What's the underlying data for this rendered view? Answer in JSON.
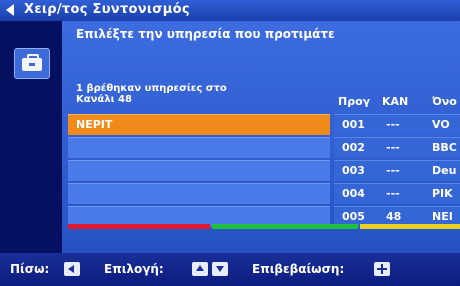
{
  "header": {
    "title": "Χειρ/τος Συντονισμός",
    "back_icon": "back-arrow-icon"
  },
  "sidebar": {
    "icon": "toolbox-icon"
  },
  "main": {
    "instruction": "Επιλέξτε την υπηρεσία που προτιμάτε",
    "found_line1": "1 βρέθηκαν υπηρεσίες στο",
    "found_line2": "Κανάλι 48"
  },
  "services": [
    {
      "name": "ΝΕΡΙΤ",
      "selected": true
    },
    {
      "name": "",
      "selected": false
    },
    {
      "name": "",
      "selected": false
    },
    {
      "name": "",
      "selected": false
    },
    {
      "name": "",
      "selected": false
    }
  ],
  "channel_table": {
    "headers": {
      "prog": "Προγ",
      "kan": "ΚΑΝ",
      "name": "Όνο"
    },
    "rows": [
      {
        "prog": "001",
        "kan": "---",
        "name": "VO"
      },
      {
        "prog": "002",
        "kan": "---",
        "name": "BBC"
      },
      {
        "prog": "003",
        "kan": "---",
        "name": "Deu"
      },
      {
        "prog": "004",
        "kan": "---",
        "name": "ΡΙΚ"
      },
      {
        "prog": "005",
        "kan": "48",
        "name": "ΝΕΙ"
      }
    ]
  },
  "footer": {
    "back_label": "Πίσω:",
    "select_label": "Επιλογή:",
    "confirm_label": "Επιβεβαίωση:"
  },
  "colors": {
    "background": "#0a1a78",
    "panel": "#2752c2",
    "selected": "#f08a1a",
    "bar_red": "#e0182e",
    "bar_green": "#1fc23a",
    "bar_yellow": "#e8d020"
  }
}
